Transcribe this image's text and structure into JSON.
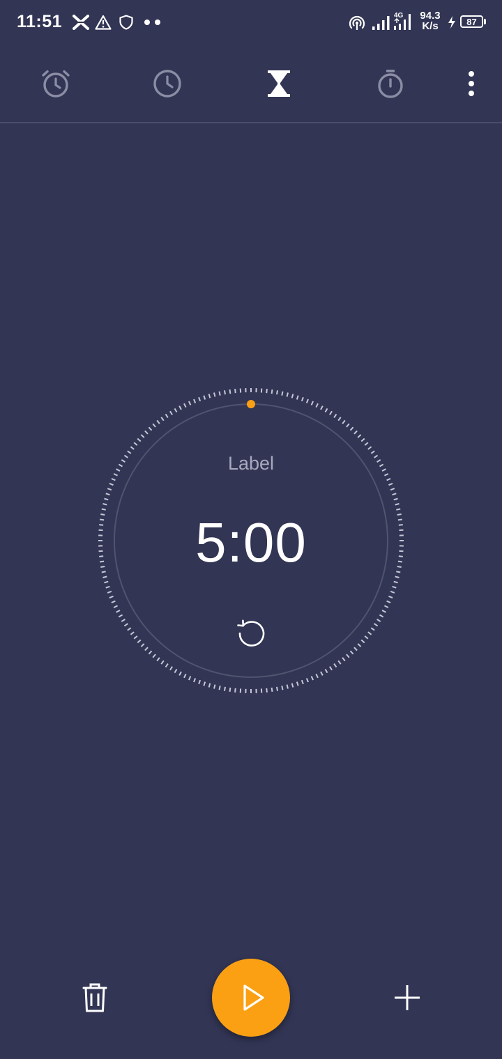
{
  "status_bar": {
    "time": "11:51",
    "icons": [
      "x-app-icon",
      "warning-icon",
      "shield-icon",
      "dots-icon",
      "hotspot-icon",
      "signal-icon",
      "4g-signal-icon",
      "charging-icon"
    ],
    "network_speed_value": "94.3",
    "network_speed_unit": "K/s",
    "network_type": "4G",
    "battery_level": "87"
  },
  "tabs": [
    {
      "name": "alarm",
      "icon": "alarm-clock-icon",
      "active": false
    },
    {
      "name": "clock",
      "icon": "clock-icon",
      "active": false
    },
    {
      "name": "timer",
      "icon": "hourglass-icon",
      "active": true
    },
    {
      "name": "stopwatch",
      "icon": "stopwatch-icon",
      "active": false
    }
  ],
  "overflow_icon": "more-vertical-icon",
  "timer": {
    "label": "Label",
    "time": "5:00",
    "progress": 1.0,
    "reset_icon": "reset-icon"
  },
  "actions": {
    "delete_icon": "trash-icon",
    "play_icon": "play-icon",
    "add_icon": "plus-icon"
  },
  "colors": {
    "background": "#323554",
    "accent": "#fba013",
    "active_icon": "#ffffff",
    "inactive_icon": "#8b8da4",
    "label_text": "#a7a9bd"
  }
}
